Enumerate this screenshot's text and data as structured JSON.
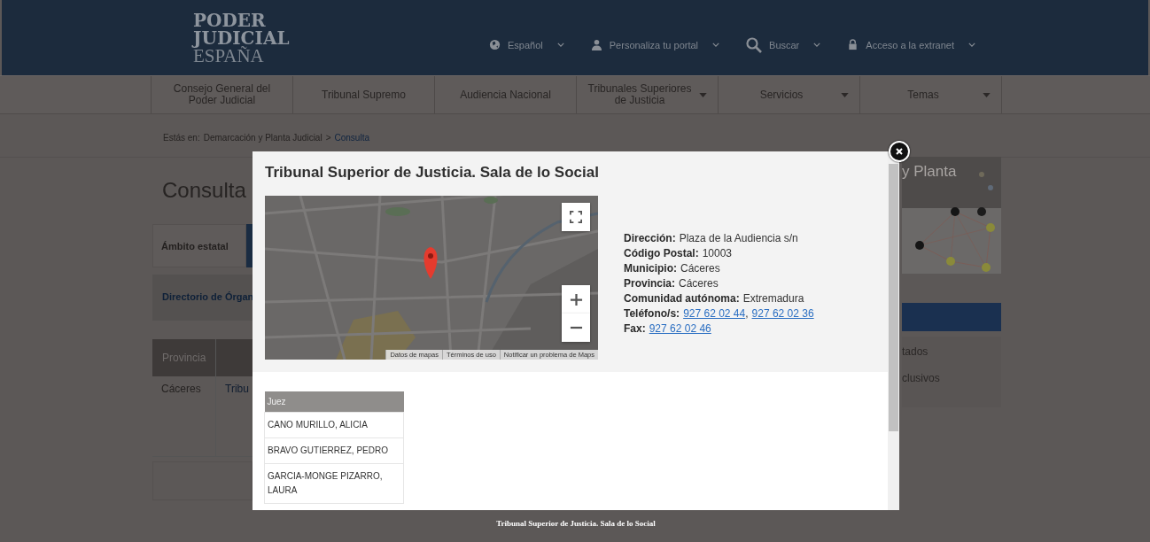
{
  "header": {
    "logo": {
      "line_1": "PODER",
      "line_2": "JUDICIAL",
      "line_3": "ESPAÑA"
    },
    "top_links": [
      {
        "label": "Español"
      },
      {
        "label": "Personaliza tu portal"
      },
      {
        "label": "Buscar"
      },
      {
        "label": "Acceso a la extranet"
      }
    ]
  },
  "nav": [
    {
      "label": "Consejo General del Poder Judicial",
      "dropdown": false
    },
    {
      "label": "Tribunal Supremo",
      "dropdown": false
    },
    {
      "label": "Audiencia Nacional",
      "dropdown": false
    },
    {
      "label": "Tribunales Superiores de Justicia",
      "dropdown": true
    },
    {
      "label": "Servicios",
      "dropdown": true
    },
    {
      "label": "Temas",
      "dropdown": true
    }
  ],
  "breadcrumb": {
    "prefix": "Estás en:",
    "separator": ">",
    "items": [
      {
        "label": "Demarcación y Planta Judicial",
        "current": false
      },
      {
        "label": "Consulta",
        "current": true
      }
    ]
  },
  "page_title": "Consulta",
  "tabs": [
    {
      "label": "Ámbito estatal",
      "selected": false
    },
    {
      "selected": true
    }
  ],
  "directory_link": "Directorio de Órgan",
  "results_table": {
    "columns": [
      "Provincia"
    ],
    "rows": [
      [
        "Cáceres",
        "Tribu"
      ]
    ]
  },
  "sidebar": {
    "banner_text": "y Planta",
    "items": [
      "tados",
      "clusivos"
    ]
  },
  "modal": {
    "title": "Tribunal Superior de Justicia. Sala de lo Social",
    "map": {
      "attribution": [
        "Datos de mapas",
        "Términos de uso",
        "Notificar un problema de Maps"
      ]
    },
    "details": [
      {
        "label": "Dirección:",
        "value": "Plaza de la Audiencia s/n"
      },
      {
        "label": "Código Postal:",
        "value": "10003"
      },
      {
        "label": "Municipio:",
        "value": "Cáceres"
      },
      {
        "label": "Provincia:",
        "value": "Cáceres"
      },
      {
        "label": "Comunidad autónoma:",
        "value": "Extremadura"
      },
      {
        "label": "Teléfono/s:",
        "links": [
          "927 62 02 44",
          "927 62 02 36"
        ],
        "separator": ","
      },
      {
        "label": "Fax:",
        "links": [
          "927 62 02 46"
        ]
      }
    ],
    "judges_table": {
      "columns": [
        "Juez"
      ],
      "rows": [
        "CANO MURILLO, ALICIA",
        "BRAVO GUTIERREZ, PEDRO",
        "GARCIA-MONGE PIZARRO, LAURA"
      ]
    }
  },
  "caption": "Tribunal Superior de Justicia. Sala de lo Social"
}
